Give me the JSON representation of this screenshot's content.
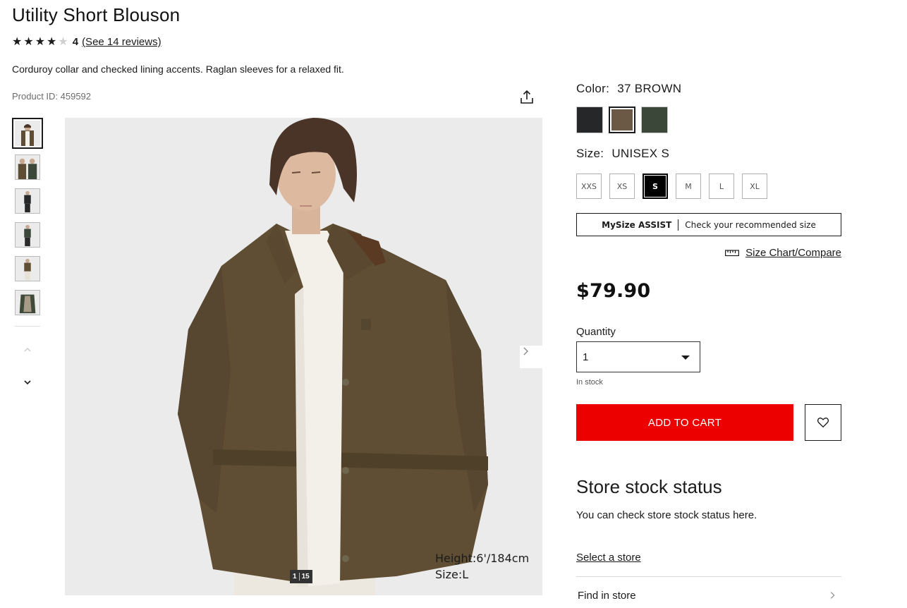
{
  "product": {
    "title": "Utility Short Blouson",
    "rating_value": "4",
    "stars_filled": 4,
    "stars_total": 5,
    "reviews_link": "(See 14 reviews)",
    "description": "Corduroy collar and checked lining accents. Raglan sleeves for a relaxed fit.",
    "product_id": "Product ID: 459592"
  },
  "icons": {
    "share": "share-icon",
    "thumb_up": "chevron-up-icon",
    "thumb_down": "chevron-down-icon",
    "next": "chevron-right-icon",
    "ruler": "ruler-icon",
    "heart": "heart-icon",
    "find_store_arrow": "chevron-right-icon"
  },
  "gallery": {
    "thumbnails_count": 6,
    "active_thumbnail": 1,
    "counter_current": "1",
    "counter_total": "15",
    "model_height": "Height:6'/184cm",
    "model_size": "Size:L"
  },
  "color": {
    "label": "Color:",
    "value": "37 BROWN",
    "swatches": [
      {
        "name": "black",
        "hex": "#262729",
        "active": false
      },
      {
        "name": "brown",
        "hex": "#6b5845",
        "active": true
      },
      {
        "name": "green",
        "hex": "#3a4739",
        "active": false
      }
    ]
  },
  "size": {
    "label": "Size:",
    "value": "UNISEX S",
    "options": [
      "XXS",
      "XS",
      "S",
      "M",
      "L",
      "XL"
    ],
    "selected": "S"
  },
  "mysize": {
    "brand": "MySize ASSIST",
    "text": "Check your recommended size"
  },
  "size_chart": {
    "label": "Size Chart/Compare"
  },
  "price": "$79.90",
  "quantity": {
    "label": "Quantity",
    "value": "1",
    "stock": "In stock"
  },
  "actions": {
    "add_to_cart": "ADD TO CART"
  },
  "store": {
    "title": "Store stock status",
    "description": "You can check store stock status here.",
    "select_link": "Select a store",
    "find_label": "Find in store"
  },
  "colors": {
    "accent_red": "#ed0000",
    "text": "#1b1b1b",
    "image_bg": "#ebebec",
    "jacket": "#5f4e33"
  }
}
